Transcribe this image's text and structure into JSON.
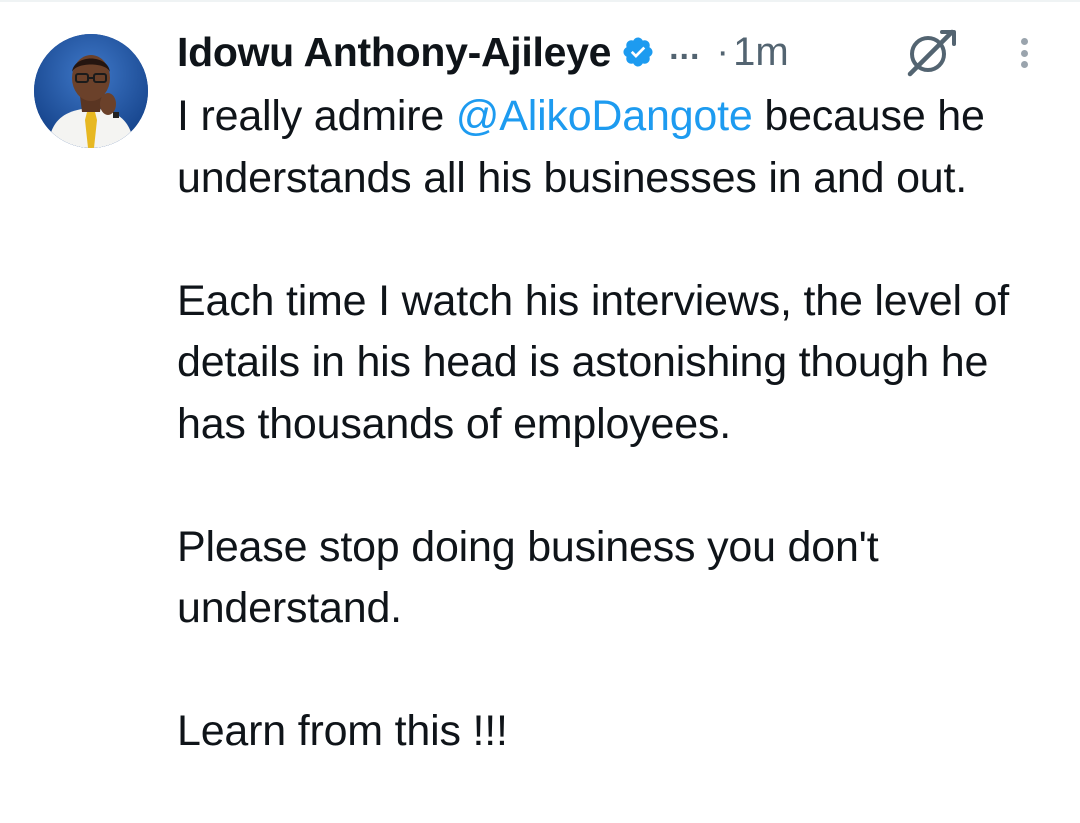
{
  "tweet": {
    "author": {
      "display_name": "Idowu Anthony-Ajileye",
      "verified_icon": "verified-badge-icon",
      "avatar_icon": "profile-photo"
    },
    "more_indicator": "...",
    "separator": "·",
    "timestamp": "1m",
    "grok_icon": "grok-icon",
    "more_icon": "vertical-more-icon",
    "colors": {
      "text": "#0f1419",
      "secondary": "#536471",
      "link": "#1d9bf0",
      "verified": "#1d9bf0"
    },
    "body": {
      "p1_before": "I really admire ",
      "p1_mention": "@AlikoDangote",
      "p1_after": " because he understands all his businesses in and out.",
      "p2": "Each time I watch his interviews, the level of details in his head is astonishing though he has thousands of employees.",
      "p3": "Please stop doing business you don't understand.",
      "p4": "Learn from this !!!"
    }
  }
}
